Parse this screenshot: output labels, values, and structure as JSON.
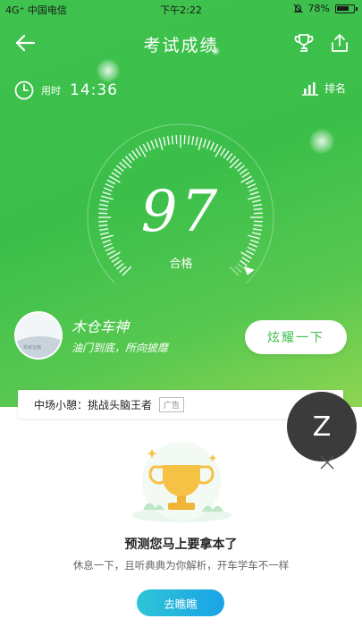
{
  "status_bar": {
    "carrier": "4G⁺ 中国电信",
    "time": "下午2:22",
    "battery": "78%"
  },
  "header": {
    "title": "考试成绩",
    "back_icon": "back-arrow-icon",
    "trophy_icon": "trophy-icon",
    "share_icon": "share-icon"
  },
  "exam": {
    "time_label": "用时",
    "time_value": "14:36",
    "rank_label": "排名",
    "score": "97",
    "result": "合格",
    "score_fraction": 0.97
  },
  "user": {
    "name": "木仓车神",
    "motto": "油门到底，所向披靡",
    "avatar_caption": "驾考宝典"
  },
  "show_off_button": "炫耀一下",
  "ad": {
    "text": "中场小憩：挑战头脑王者",
    "tag": "广告"
  },
  "floating_badge": "Z",
  "promo": {
    "title": "预测您马上要拿本了",
    "subtitle": "休息一下，且听典典为你解析，开车学车不一样",
    "button": "去瞧瞧"
  },
  "colors": {
    "primary_green": "#3fc24e",
    "accent_cyan": "#1aa3e6"
  }
}
